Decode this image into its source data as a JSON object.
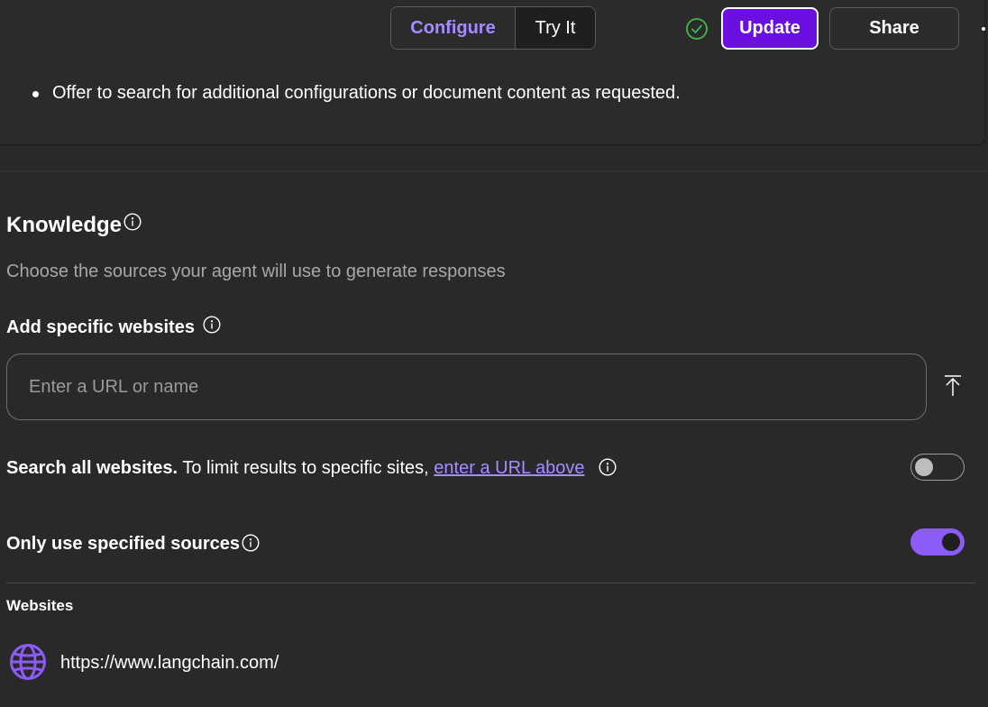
{
  "instructions": {
    "bullet_text": "Offer to search for additional configurations or document content as requested."
  },
  "header": {
    "tabs": [
      {
        "label": "Configure",
        "active": true
      },
      {
        "label": "Try It",
        "active": false
      }
    ],
    "status_icon": "check-circle-icon",
    "update_label": "Update",
    "share_label": "Share",
    "more_icon": "more-icon"
  },
  "knowledge": {
    "title": "Knowledge",
    "description": "Choose the sources your agent will use to generate responses",
    "add_websites_label": "Add specific websites",
    "url_input": {
      "value": "",
      "placeholder": "Enter a URL or name"
    },
    "search_all": {
      "bold_text": "Search all websites.",
      "text": "To limit results to specific sites,",
      "link_text": "enter a URL above",
      "enabled": false
    },
    "only_specified": {
      "label": "Only use specified sources",
      "enabled": true
    },
    "websites_header": "Websites",
    "websites": [
      {
        "url": "https://www.langchain.com/",
        "icon": "globe-icon"
      }
    ]
  },
  "colors": {
    "accent": "#8b5cf6",
    "update_button": "#6b0fe0",
    "link": "#a58cff",
    "success": "#3fb950",
    "background": "#292929"
  }
}
